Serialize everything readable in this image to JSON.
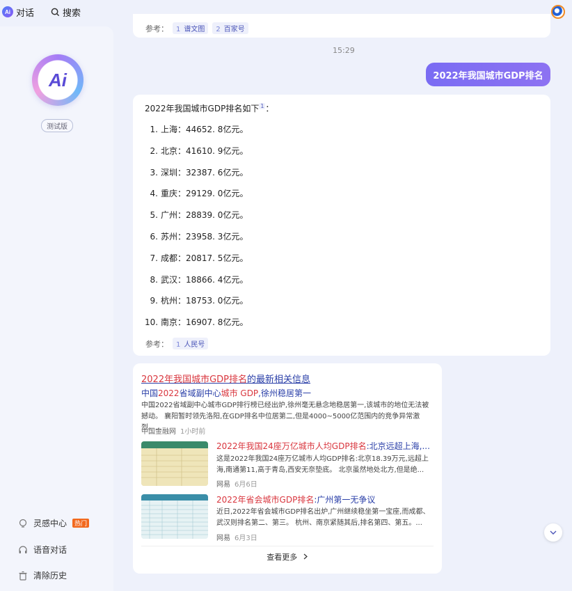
{
  "topbar": {
    "chat_label": "对话",
    "search_label": "搜索"
  },
  "sidebar": {
    "beta_label": "测试版",
    "items": [
      {
        "icon": "lightbulb-icon",
        "label": "灵感中心",
        "badge": "热门"
      },
      {
        "icon": "headphones-icon",
        "label": "语音对话"
      },
      {
        "icon": "trash-icon",
        "label": "清除历史"
      }
    ]
  },
  "prev_refs": {
    "label": "参考：",
    "chips": [
      {
        "n": "1",
        "text": "谱文图"
      },
      {
        "n": "2",
        "text": "百家号"
      }
    ]
  },
  "time": "15:29",
  "user_message": "2022年我国城市GDP排名",
  "answer": {
    "intro": "2022年我国城市GDP排名如下",
    "intro_sup": "1",
    "intro_tail": "：",
    "items": [
      {
        "num": "1.",
        "text": "上海：44652. 8亿元。"
      },
      {
        "num": "2.",
        "text": "北京：41610. 9亿元。"
      },
      {
        "num": "3.",
        "text": "深圳：32387. 6亿元。"
      },
      {
        "num": "4.",
        "text": "重庆：29129. 0亿元。"
      },
      {
        "num": "5.",
        "text": "广州：28839. 0亿元。"
      },
      {
        "num": "6.",
        "text": "苏州：23958. 3亿元。"
      },
      {
        "num": "7.",
        "text": "成都：20817. 5亿元。"
      },
      {
        "num": "8.",
        "text": "武汉：18866. 4亿元。"
      },
      {
        "num": "9.",
        "text": "杭州：18753. 0亿元。"
      },
      {
        "num": "10.",
        "text": "南京：16907. 8亿元。"
      }
    ],
    "ref_label": "参考：",
    "ref_chip": {
      "n": "1",
      "text": "人民号"
    }
  },
  "news": {
    "header_red": "2022年我国城市GDP排名",
    "header_rest": "的最新相关信息",
    "item1": {
      "title_a": "中国",
      "title_b": "2022",
      "title_c": "省域副中心",
      "title_d": "城市 GDP",
      "title_e": ",徐州稳居第一",
      "body": "中国2022省域副中心城市GDP排行榜已经出炉,徐州毫无悬念地稳居第一,该城市的地位无法被撼动。 襄阳暂时领先洛阳,在GDP排名中位居第二,但是4000~5000亿范围内的竞争异常激烈。...",
      "source": "中国金融网",
      "time": "1小时前"
    },
    "item2": {
      "title_red": "2022年我国24座万亿城市人均GDP排名",
      "title_rest": ":北京远超上海,...",
      "body": "这是2022年我国24座万亿城市人均GDP排名:北京18.39万元,远超上海,南通第11,高于青岛,西安无奈垫底。 北京虽然地处北方,但是绝...",
      "source": "网易",
      "time": "6月6日"
    },
    "item3": {
      "title_red": "2022年省会城市GDP排名",
      "title_rest": ":广州第一无争议",
      "body": "近日,2022年省会城市GDP排名出炉,广州继续稳坐第一宝座,而成都、武汉则排名第二、第三。 杭州、南京紧随其后,排名第四、第五。...",
      "source": "网易",
      "time": "6月3日"
    },
    "more_label": "查看更多",
    "more_icon": "chevron-right-icon"
  },
  "colors": {
    "accent": "#7a6cf3",
    "link": "#2a3fa8",
    "highlight": "#d9363e",
    "hot_badge": "#f2691d"
  }
}
